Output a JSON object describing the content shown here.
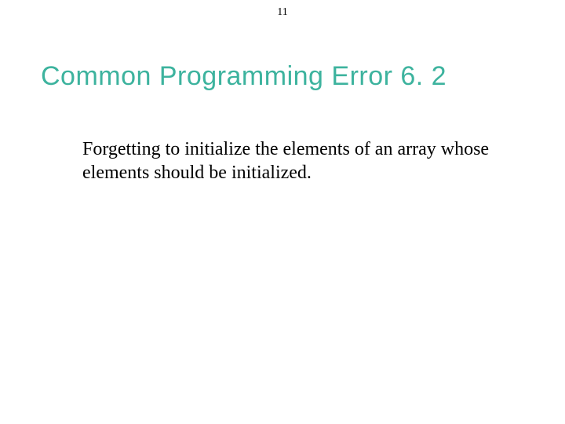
{
  "page_number": "11",
  "heading": "Common Programming Error 6. 2",
  "body": "Forgetting to initialize the elements of an array whose elements should be initialized."
}
